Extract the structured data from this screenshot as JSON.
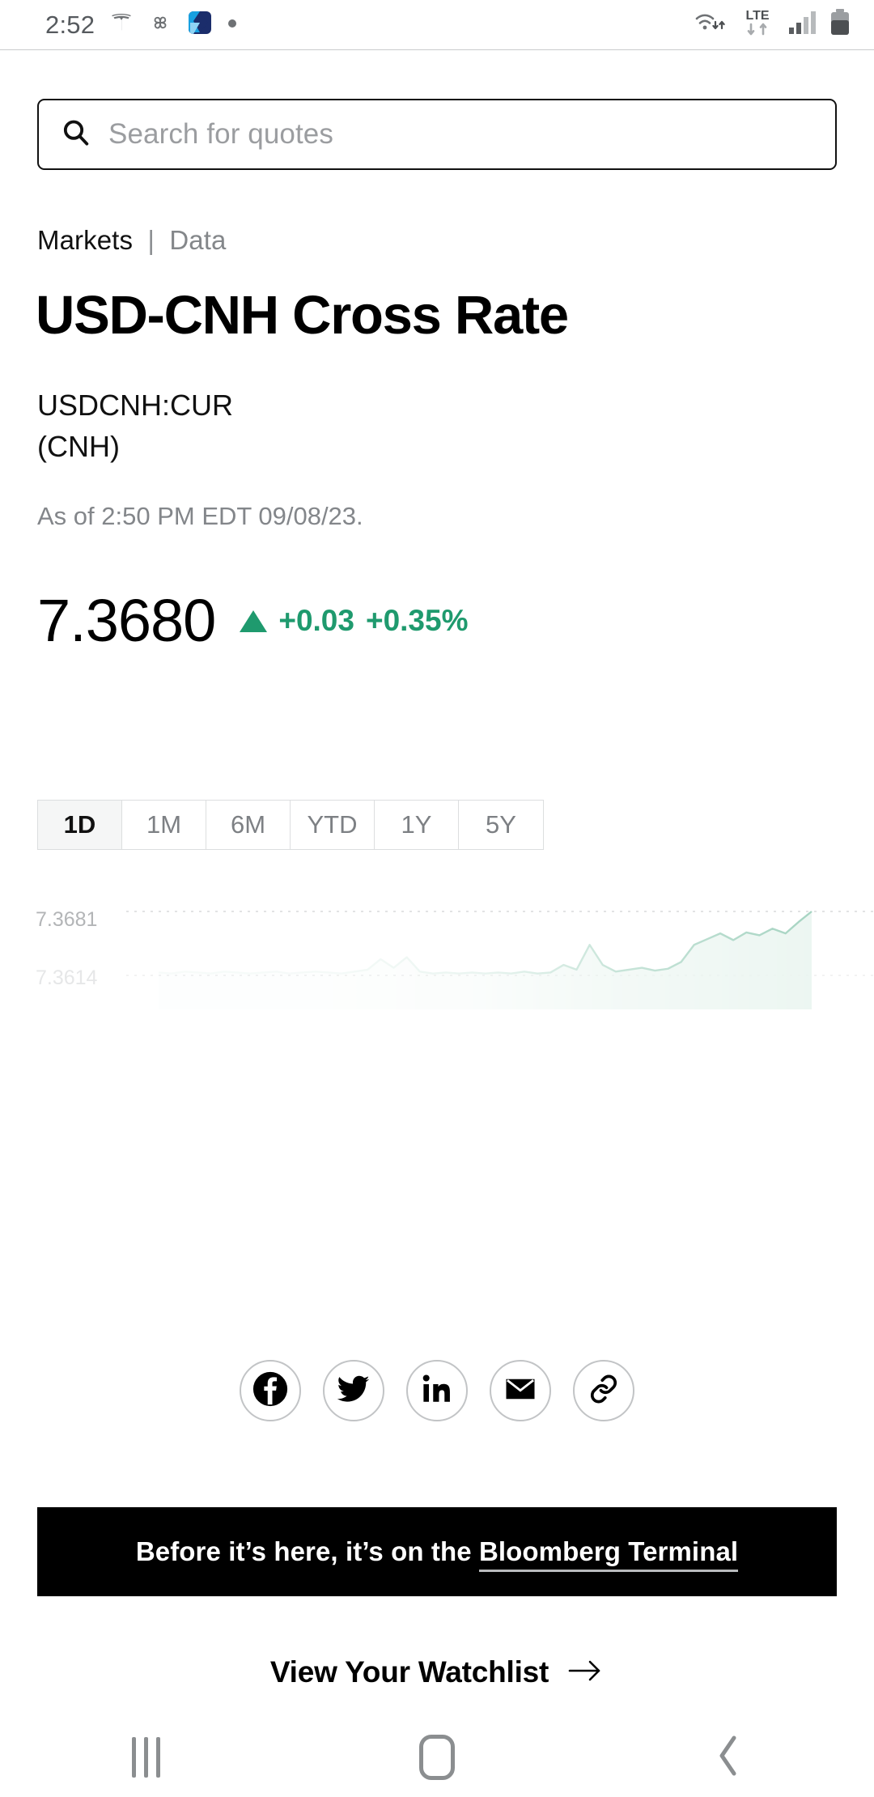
{
  "theme": {
    "accent_up": "#1f9a6e",
    "banner_bg": "#000000",
    "text": "#111111",
    "muted": "#83868a"
  },
  "status_bar": {
    "time": "2:52",
    "left_icons": [
      "tesla-icon",
      "pinwheel-icon",
      "capitalone-icon",
      "dot-icon"
    ],
    "right_icons": [
      "wifi-icon",
      "lte-icon",
      "signal-icon",
      "battery-icon"
    ],
    "network_label": "LTE"
  },
  "search": {
    "placeholder": "Search for quotes",
    "value": "",
    "icon": "search-icon"
  },
  "breadcrumb": {
    "primary": "Markets",
    "separator": "|",
    "secondary": "Data"
  },
  "header": {
    "title": "USD-CNH Cross Rate",
    "ticker": "USDCNH:CUR",
    "currency": "(CNH)",
    "as_of": "As of 2:50 PM EDT 09/08/23."
  },
  "quote": {
    "price": "7.3680",
    "direction": "up",
    "change_absolute": "+0.03",
    "change_percent": "+0.35%"
  },
  "ranges": {
    "selected": "1D",
    "items": [
      {
        "label": "1D",
        "active": true
      },
      {
        "label": "1M",
        "active": false
      },
      {
        "label": "6M",
        "active": false
      },
      {
        "label": "YTD",
        "active": false
      },
      {
        "label": "1Y",
        "active": false
      },
      {
        "label": "5Y",
        "active": false
      }
    ]
  },
  "chart_data": {
    "type": "line",
    "title": "",
    "xlabel": "",
    "ylabel": "",
    "grid": true,
    "legend": null,
    "ylim": [
      7.3614,
      7.3681
    ],
    "ytick_labels": [
      "7.3681",
      "7.3614"
    ],
    "ytick_values": [
      7.3681,
      7.3614
    ],
    "line_color": "#9ccfbb",
    "fill_color": "#eaf5f0",
    "note": "intraday 1D line, rendered faded / partially loaded; left half nearly invisible",
    "x": [
      0,
      2,
      4,
      6,
      8,
      10,
      12,
      14,
      16,
      18,
      20,
      22,
      24,
      26,
      28,
      30,
      32,
      34,
      36,
      38,
      40,
      42,
      44,
      46,
      48,
      50,
      52,
      54,
      56,
      58,
      60,
      62,
      64,
      66,
      68,
      70,
      72,
      74,
      76,
      78,
      80,
      82,
      84,
      86,
      88,
      90,
      92,
      94,
      96,
      98,
      100
    ],
    "values": [
      7.3617,
      7.3616,
      7.3618,
      7.3617,
      7.3616,
      7.3618,
      7.3617,
      7.3616,
      7.3617,
      7.3618,
      7.3616,
      7.3617,
      7.3618,
      7.3617,
      7.3616,
      7.3618,
      7.362,
      7.3631,
      7.3622,
      7.3633,
      7.3618,
      7.3616,
      7.3617,
      7.3616,
      7.3617,
      7.3616,
      7.3617,
      7.3616,
      7.3618,
      7.3616,
      7.3617,
      7.3625,
      7.362,
      7.3646,
      7.3625,
      7.3618,
      7.362,
      7.3622,
      7.3619,
      7.3621,
      7.3628,
      7.3646,
      7.3652,
      7.3658,
      7.3651,
      7.3659,
      7.3656,
      7.3663,
      7.3658,
      7.367,
      7.3681
    ]
  },
  "share": {
    "items": [
      {
        "name": "facebook-icon",
        "label": "Facebook"
      },
      {
        "name": "twitter-icon",
        "label": "Twitter"
      },
      {
        "name": "linkedin-icon",
        "label": "LinkedIn"
      },
      {
        "name": "email-icon",
        "label": "Email"
      },
      {
        "name": "link-icon",
        "label": "Copy link"
      }
    ]
  },
  "banner": {
    "prefix": "Before it’s here, it’s on the ",
    "link": "Bloomberg Terminal"
  },
  "watchlist": {
    "label": "View Your Watchlist",
    "icon": "arrow-right-icon"
  },
  "nav_bar": {
    "recents": "recents-icon",
    "home": "home-icon",
    "back": "back-icon"
  }
}
